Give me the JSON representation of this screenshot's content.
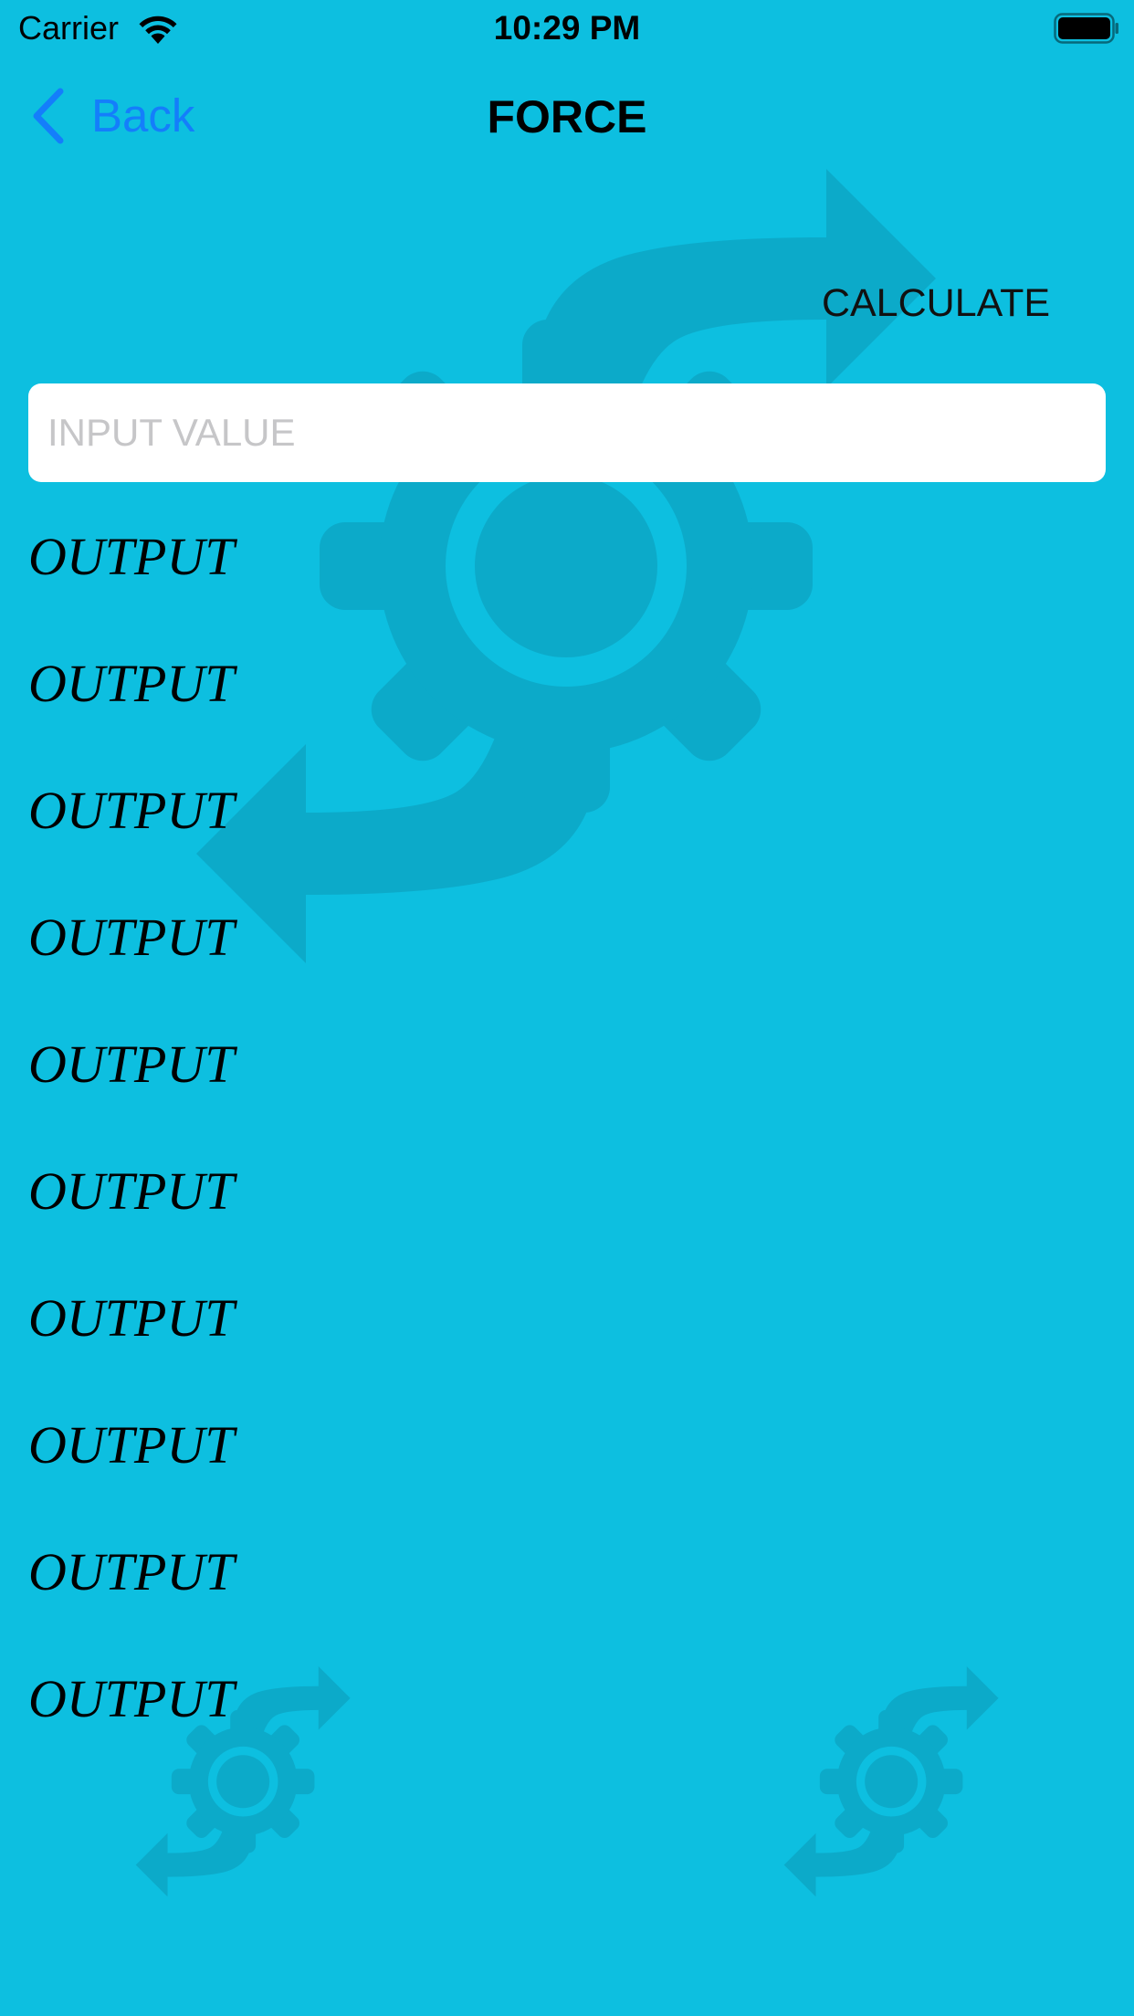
{
  "status_bar": {
    "carrier": "Carrier",
    "time": "10:29 PM",
    "icons": [
      "wifi-icon",
      "battery-icon"
    ]
  },
  "nav": {
    "back_label": "Back",
    "title": "FORCE",
    "back_icon": "chevron-left-icon"
  },
  "actions": {
    "calculate_label": "CALCULATE"
  },
  "input": {
    "placeholder": "INPUT VALUE",
    "value": ""
  },
  "outputs": [
    "OUTPUT",
    "OUTPUT",
    "OUTPUT",
    "OUTPUT",
    "OUTPUT",
    "OUTPUT",
    "OUTPUT",
    "OUTPUT",
    "OUTPUT",
    "OUTPUT"
  ],
  "background": {
    "icon": "gear-convert-icon"
  },
  "colors": {
    "background": "#0DBFE0",
    "watermark": "#0CAAC9",
    "accent": "#147EFB",
    "input_bg": "#FFFFFF",
    "placeholder": "#C6C6C8"
  }
}
